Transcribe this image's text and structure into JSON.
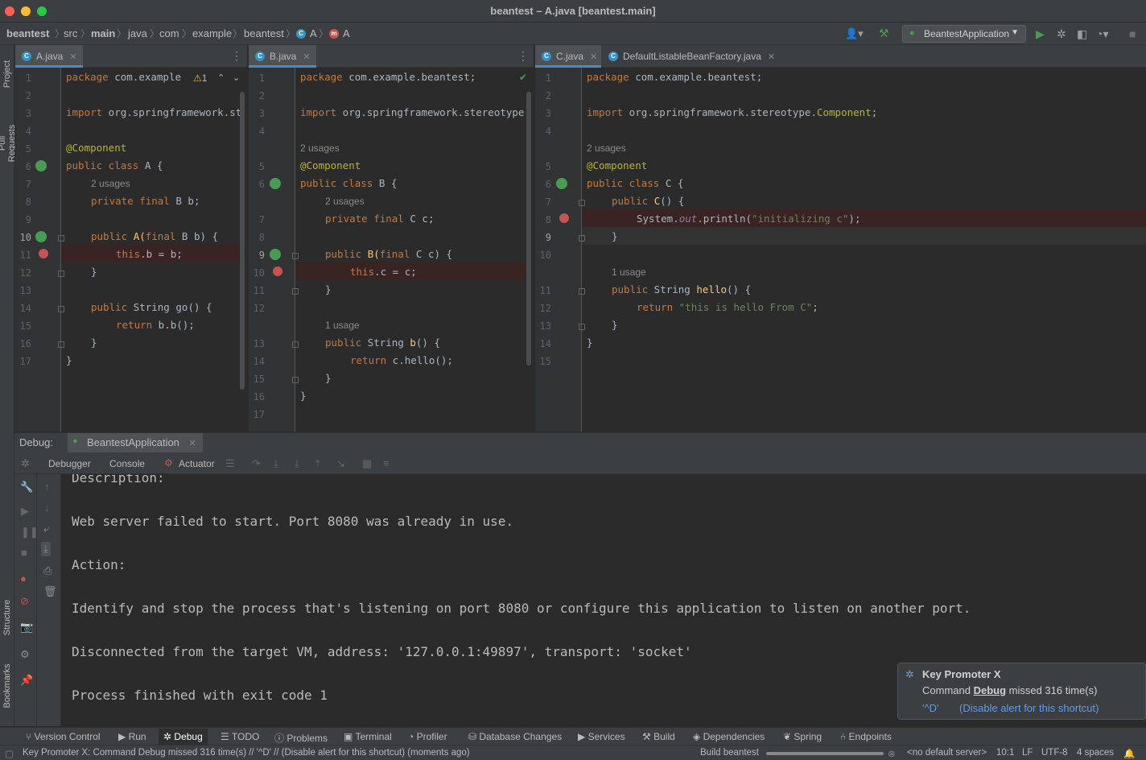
{
  "window": {
    "title": "beantest – A.java [beantest.main]"
  },
  "breadcrumbs": [
    "beantest",
    "src",
    "main",
    "java",
    "com",
    "example",
    "beantest",
    "A",
    "A"
  ],
  "toolbar": {
    "run_config": "BeantestApplication"
  },
  "left_strip": {
    "project": "Project",
    "pull_requests": "Pull Requests",
    "structure": "Structure",
    "bookmarks": "Bookmarks"
  },
  "pane_a": {
    "tab": "A.java",
    "inspection": "1",
    "line_numbers": [
      "1",
      "2",
      "3",
      "4",
      "5",
      "6",
      "7",
      "8",
      "9",
      "10",
      "11",
      "12",
      "13",
      "14",
      "15",
      "16",
      "17"
    ],
    "lines": {
      "l1_kw": "package",
      "l1_rest": " com.example",
      "l3_kw": "import",
      "l3_rest": " org.springframework.st",
      "l5": "@Component",
      "l6_kw": "public class",
      "l6_rest": " A {",
      "l6_hint": "2 usages",
      "l7_kw": "private final",
      "l7_rest": " B b;",
      "l9_kw": "public",
      "l9_fn": "A(",
      "l9_kw2": "final",
      "l9_rest": " B b) {",
      "l10_kw": "this",
      "l10_rest": ".b = b;",
      "l11": "}",
      "l13_kw": "public",
      "l13_type": " String ",
      "l13_fn": "go",
      "l13_rest": "() {",
      "l14_kw": "return",
      "l14_rest": " b.b();",
      "l15": "}",
      "l16": "}"
    }
  },
  "pane_b": {
    "tab": "B.java",
    "line_numbers": [
      "1",
      "2",
      "3",
      "4",
      "",
      "5",
      "6",
      "",
      "7",
      "8",
      "9",
      "10",
      "11",
      "12",
      "",
      "13",
      "14",
      "15",
      "16",
      "17"
    ],
    "lines": {
      "l1_kw": "package",
      "l1_rest": " com.example.beantest;",
      "l3_kw": "import",
      "l3_rest": " org.springframework.stereotype",
      "h5": "2 usages",
      "l5": "@Component",
      "l6_kw": "public class",
      "l6_rest": " B {",
      "h7": "2 usages",
      "l7_kw": "private final",
      "l7_rest": " C c;",
      "l9_kw": "public",
      "l9_fn": "B(",
      "l9_kw2": "final",
      "l9_rest": " C c) {",
      "l10_kw": "this",
      "l10_rest": ".c = c;",
      "l11": "}",
      "h13": "1 usage",
      "l13_kw": "public",
      "l13_type": " String ",
      "l13_fn": "b",
      "l13_rest": "() {",
      "l14_kw": "return",
      "l14_rest": " c.hello();",
      "l15": "}",
      "l16": "}"
    }
  },
  "pane_c": {
    "tabs": [
      "C.java",
      "DefaultListableBeanFactory.java"
    ],
    "line_numbers": [
      "1",
      "2",
      "3",
      "4",
      "",
      "5",
      "6",
      "7",
      "8",
      "9",
      "10",
      "",
      "11",
      "12",
      "13",
      "14",
      "15"
    ],
    "lines": {
      "l1_kw": "package",
      "l1_rest": " com.example.beantest;",
      "l3_kw": "import",
      "l3_rest": " org.springframework.stereotype.",
      "l3_an": "Component",
      "l3_end": ";",
      "h5": "2 usages",
      "l5": "@Component",
      "l6_kw": "public class",
      "l6_rest": " C {",
      "l7_kw": "public",
      "l7_fn": "C",
      "l7_rest": "() {",
      "l8_a": "System.",
      "l8_it": "out",
      "l8_b": ".println(",
      "l8_st": "\"initializing c\"",
      "l8_c": ");",
      "l9": "}",
      "h11": "1 usage",
      "l11_kw": "public",
      "l11_type": " String ",
      "l11_fn": "hello",
      "l11_rest": "() {",
      "l12_kw": "return",
      "l12_st": " \"this is hello From C\"",
      "l12_end": ";",
      "l13": "}",
      "l14": "}"
    }
  },
  "debug": {
    "label": "Debug:",
    "session": "BeantestApplication",
    "tabs": [
      "Debugger",
      "Console",
      "Actuator"
    ]
  },
  "console": {
    "lines": [
      "Description:",
      "Web server failed to start. Port 8080 was already in use.",
      "Action:",
      "Identify and stop the process that's listening on port 8080 or configure this application to listen on another port.",
      "Disconnected from the target VM, address: '127.0.0.1:49897', transport: 'socket'",
      "Process finished with exit code 1"
    ]
  },
  "popup": {
    "title": "Key Promoter X",
    "msg_pre": "Command ",
    "msg_cmd": "Debug",
    "msg_post": " missed 316 time(s)",
    "shortcut": "'^D'",
    "disable": "(Disable alert for this shortcut)"
  },
  "bottom_tools": [
    "Version Control",
    "Run",
    "Debug",
    "TODO",
    "Problems",
    "Terminal",
    "Profiler",
    "Database Changes",
    "Services",
    "Build",
    "Dependencies",
    "Spring",
    "Endpoints"
  ],
  "status": {
    "message": "Key Promoter X: Command Debug missed 316 time(s) // '^D' // (Disable alert for this shortcut) (moments ago)",
    "build": "Build beantest",
    "server": "<no default server>",
    "position": "10:1",
    "line_sep": "LF",
    "encoding": "UTF-8",
    "indent": "4 spaces"
  },
  "colors": {
    "keyword": "#cc7832",
    "annotation": "#bbb529",
    "string": "#6a8759",
    "function": "#ffc66d",
    "breakpoint": "#c75450",
    "accent": "#4a88c7"
  }
}
